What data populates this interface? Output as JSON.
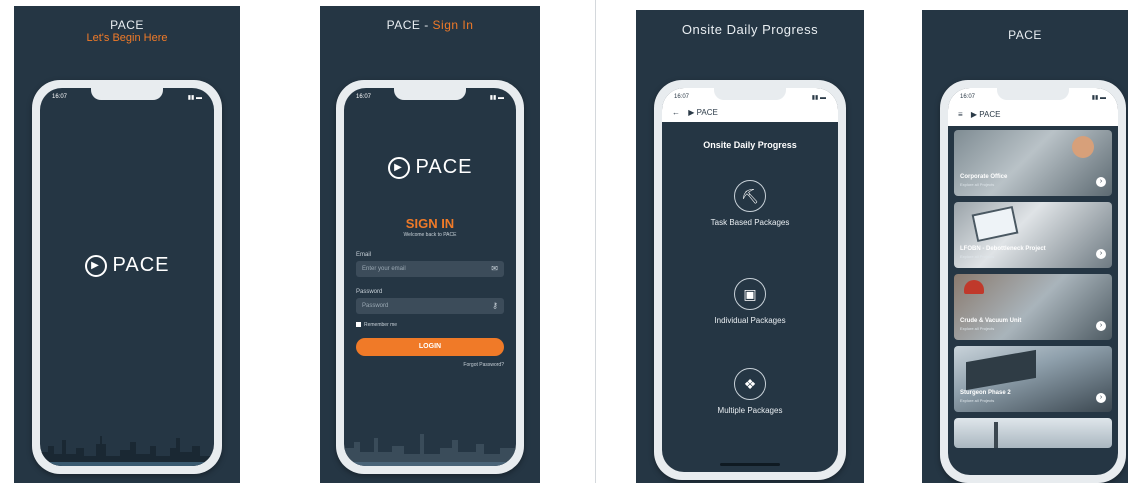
{
  "colors": {
    "panel_bg": "#253644",
    "accent": "#f07a28",
    "phone_frame": "#e8ecef"
  },
  "screen1": {
    "title": "PACE",
    "subtitle": "Let's Begin Here",
    "status_time": "16:07",
    "logo_text": "PACE",
    "logo_icon": "play-circle-icon"
  },
  "screen2": {
    "title_prefix": "PACE - ",
    "title_accent": "Sign In",
    "status_time": "16:07",
    "logo_text": "PACE",
    "heading": "SIGN IN",
    "welcome": "Welcome back to PACE",
    "email_label": "Email",
    "email_placeholder": "Enter your email",
    "email_icon": "envelope-icon",
    "password_label": "Password",
    "password_placeholder": "Password",
    "password_icon": "key-icon",
    "remember_label": "Remember me",
    "login_label": "LOGIN",
    "forgot_label": "Forgot Password?"
  },
  "screen3": {
    "title": "Onsite Daily Progress",
    "status_time": "16:07",
    "back_icon": "arrow-left-icon",
    "logo_text": "PACE",
    "heading": "Onsite Daily Progress",
    "packages": [
      {
        "label": "Task Based Packages",
        "icon": "worker-icon"
      },
      {
        "label": "Individual Packages",
        "icon": "box-icon"
      },
      {
        "label": "Multiple Packages",
        "icon": "boxes-icon"
      }
    ]
  },
  "screen4": {
    "title": "PACE",
    "status_time": "16:07",
    "menu_icon": "hamburger-icon",
    "logo_text": "PACE",
    "cards": [
      {
        "title": "Corporate Office",
        "subtitle": "Explore all Projects"
      },
      {
        "title": "LFOBN - Debottleneck Project",
        "subtitle": "Explore all Projects"
      },
      {
        "title": "Crude & Vacuum Unit",
        "subtitle": "Explore all Projects"
      },
      {
        "title": "Sturgeon Phase 2",
        "subtitle": "Explore all Projects"
      }
    ]
  }
}
